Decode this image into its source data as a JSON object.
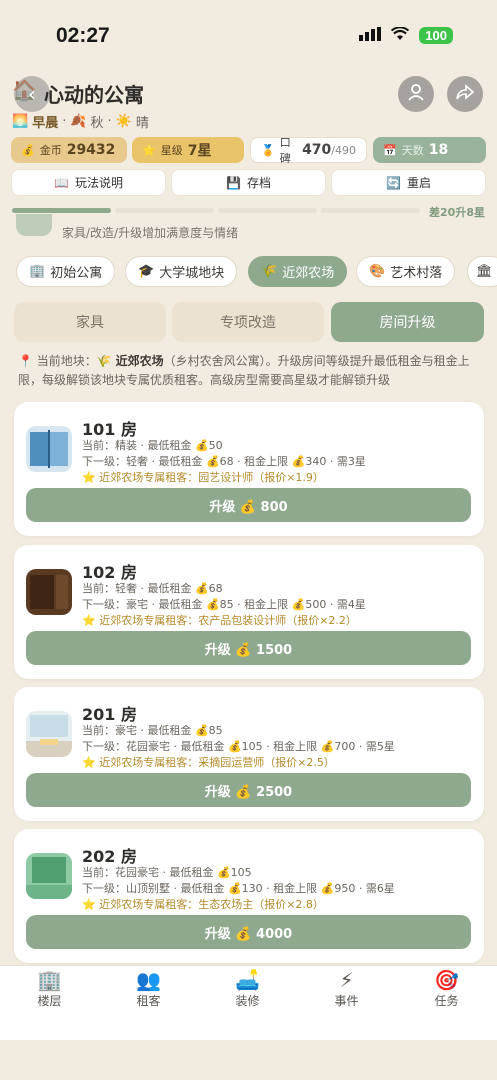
{
  "status": {
    "time": "02:27",
    "battery": "100"
  },
  "header": {
    "title": "心动的公寓",
    "title_icon": "house-icon",
    "period": "早晨",
    "season": "秋",
    "weather": "晴"
  },
  "stats": {
    "coins_label": "金币",
    "coins": "29432",
    "stars_label": "星级",
    "stars": "7星",
    "rep_label": "口碑",
    "rep": "470",
    "rep_max": "/490",
    "day_label": "天数",
    "day": "18"
  },
  "actions": {
    "guide": "玩法说明",
    "save": "存档",
    "restart": "重启"
  },
  "progress": {
    "label": "差20升8星",
    "fraction": 0.25
  },
  "partial_text": "家具/改造/升级增加满意度与情绪",
  "areas": [
    "初始公寓",
    "大学城地块",
    "近郊农场",
    "艺术村落"
  ],
  "active_area": "近郊农场",
  "tabs": [
    "家具",
    "专项改造",
    "房间升级"
  ],
  "active_tab": "房间升级",
  "location": {
    "prefix": "当前地块：",
    "name": "近郊农场",
    "desc": "（乡村农舍风公寓）。升级房间等级提升最低租金与租金上限，每级解锁该地块专属优质租客。高级房型需要高星级才能解锁升级"
  },
  "rooms": [
    {
      "name": "101 房",
      "current": "当前：精装 · 最低租金 💰50",
      "next": "下一级：轻奢 · 最低租金 💰68 · 租金上限 💰340 · 需3星",
      "tenant": "⭐ 近郊农场专属租客：园艺设计师（报价×1.9）",
      "button": "升级 💰 800"
    },
    {
      "name": "102 房",
      "current": "当前：轻奢 · 最低租金 💰68",
      "next": "下一级：豪宅 · 最低租金 💰85 · 租金上限 💰500 · 需4星",
      "tenant": "⭐ 近郊农场专属租客：农产品包装设计师（报价×2.2）",
      "button": "升级 💰 1500"
    },
    {
      "name": "201 房",
      "current": "当前：豪宅 · 最低租金 💰85",
      "next": "下一级：花园豪宅 · 最低租金 💰105 · 租金上限 💰700 · 需5星",
      "tenant": "⭐ 近郊农场专属租客：采摘园运营师（报价×2.5）",
      "button": "升级 💰 2500"
    },
    {
      "name": "202 房",
      "current": "当前：花园豪宅 · 最低租金 💰105",
      "next": "下一级：山顶别墅 · 最低租金 💰130 · 租金上限 💰950 · 需6星",
      "tenant": "⭐ 近郊农场专属租客：生态农场主（报价×2.8）",
      "button": "升级 💰 4000"
    }
  ],
  "nav": [
    "楼层",
    "租客",
    "装修",
    "事件",
    "任务"
  ],
  "active_nav": "装修"
}
